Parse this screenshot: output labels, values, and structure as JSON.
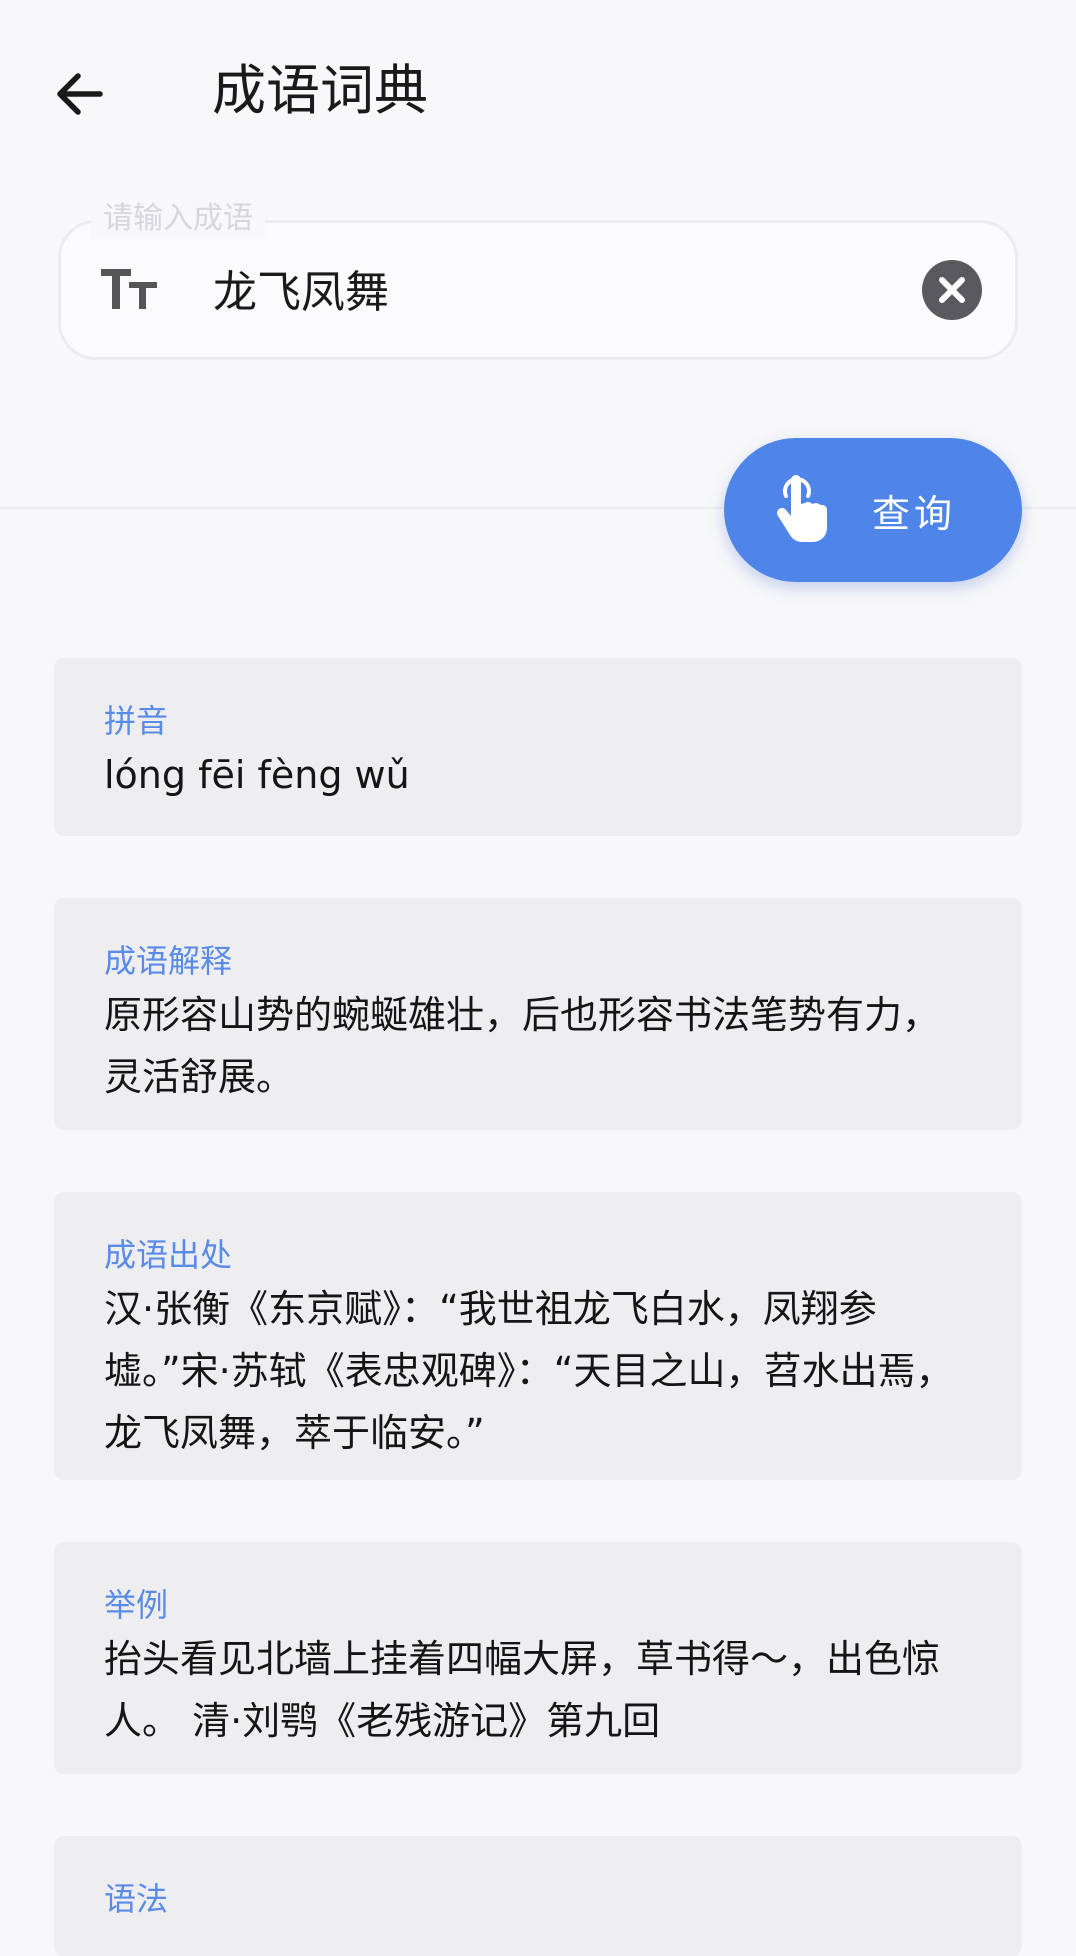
{
  "header": {
    "title": "成语词典",
    "back_icon": "arrow-left-icon"
  },
  "search": {
    "placeholder": "请输入成语",
    "value": "龙飞凤舞",
    "leading_icon": "text-size-icon",
    "clear_icon": "clear-icon"
  },
  "query_button": {
    "label": "查询",
    "icon": "tap-hand-icon",
    "color": "#4f84e8"
  },
  "colors": {
    "accent": "#5a8be6",
    "card_bg": "#eeeef1",
    "page_bg": "#f8f8fa"
  },
  "cards": [
    {
      "label": "拼音",
      "body": "lóng fēi fèng wǔ"
    },
    {
      "label": "成语解释",
      "body": "原形容山势的蜿蜒雄壮，后也形容书法笔势有力，灵活舒展。"
    },
    {
      "label": "成语出处",
      "body": "汉·张衡《东京赋》：“我世祖龙飞白水，凤翔参墟。”宋·苏轼《表忠观碑》：“天目之山，苕水出焉，龙飞凤舞，萃于临安。”"
    },
    {
      "label": "举例",
      "body": "抬头看见北墙上挂着四幅大屏，草书得～，出色惊人。 清·刘鹗《老残游记》第九回"
    },
    {
      "label": "语法",
      "body": ""
    }
  ]
}
